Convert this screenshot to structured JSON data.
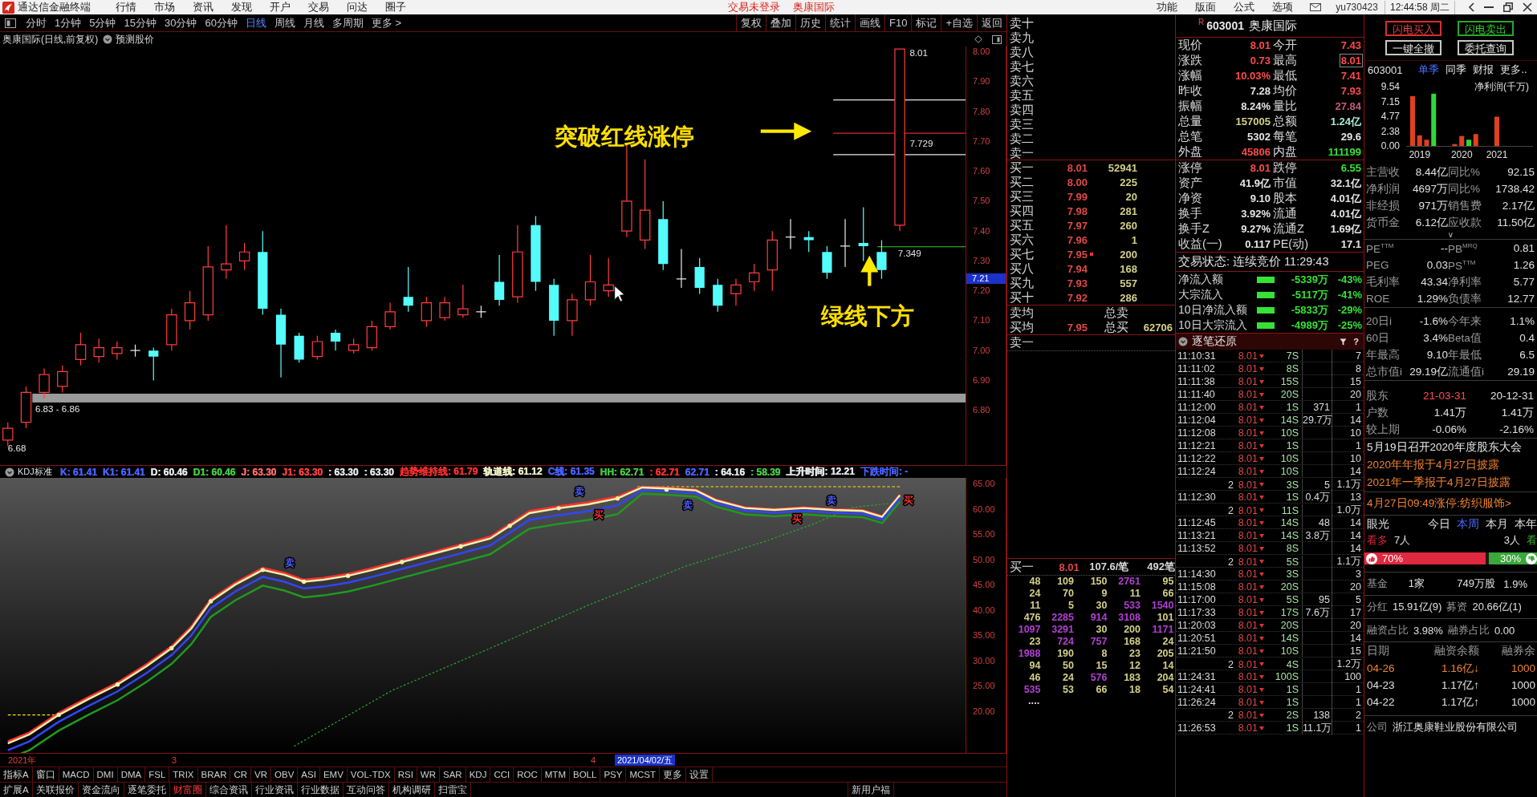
{
  "title_bar": {
    "app_name": "通达信金融终端",
    "menu": [
      "行情",
      "市场",
      "资讯",
      "发现",
      "开户",
      "交易",
      "问达",
      "圈子"
    ],
    "login_status": "交易未登录",
    "stock_name": "奥康国际",
    "right_menu": [
      "功能",
      "版面",
      "公式",
      "选项"
    ],
    "user": "yu730423",
    "clock": "12:44:58 周二"
  },
  "period_bar": {
    "tabs": [
      {
        "label": "分时",
        "selected": false
      },
      {
        "label": "1分钟",
        "selected": false
      },
      {
        "label": "5分钟",
        "selected": false
      },
      {
        "label": "15分钟",
        "selected": false
      },
      {
        "label": "30分钟",
        "selected": false
      },
      {
        "label": "60分钟",
        "selected": false
      },
      {
        "label": "日线",
        "selected": true
      },
      {
        "label": "周线",
        "selected": false
      },
      {
        "label": "月线",
        "selected": false
      },
      {
        "label": "多周期",
        "selected": false
      },
      {
        "label": "更多 >",
        "selected": false
      }
    ],
    "tools": [
      "复权",
      "叠加",
      "历史",
      "统计",
      "画线",
      "F10",
      "标记",
      "+自选",
      "返回"
    ]
  },
  "chart": {
    "title": "奥康国际(日线,前复权)",
    "forecast_label": "预测股价",
    "price_axis": [
      "8.00",
      "7.90",
      "7.80",
      "7.70",
      "7.60",
      "7.50",
      "7.40",
      "7.30",
      "7.20",
      "7.10",
      "7.00",
      "6.90",
      "6.80"
    ],
    "cursor_price": "7.21",
    "labels": [
      {
        "kind": "high",
        "text": "8.01"
      },
      {
        "kind": "resistance",
        "text": "7.729"
      },
      {
        "kind": "support",
        "text": "7.349"
      },
      {
        "kind": "band",
        "text": "6.83 - 6.86"
      },
      {
        "kind": "low",
        "text": "6.68"
      }
    ],
    "annotations": [
      {
        "kind": "right-arrow",
        "text": "突破红线涨停"
      },
      {
        "kind": "up-arrow",
        "text": "绿线下方"
      }
    ]
  },
  "indicator": {
    "name": "KDJ标准",
    "readouts": [
      {
        "text": "K: 61.41",
        "color": "#4a63ff"
      },
      {
        "text": "K1: 61.41",
        "color": "#4a63ff"
      },
      {
        "text": "D: 60.46",
        "color": "#e6e6e6"
      },
      {
        "text": "D1: 60.46",
        "color": "#46c846"
      },
      {
        "text": "J: 63.30",
        "color": "#ff6a6a"
      },
      {
        "text": "J1: 63.30",
        "color": "#ff4040"
      },
      {
        "text": ": 63.30",
        "color": "#e6e6e6"
      },
      {
        "text": ": 63.30",
        "color": "#e6e6e6"
      },
      {
        "text": "趋势维持线: 61.79",
        "color": "#ff3030"
      },
      {
        "text": "轨道线: 61.12",
        "color": "#f2f2c8"
      },
      {
        "text": "C线: 61.35",
        "color": "#4a63ff"
      },
      {
        "text": "HH: 62.71",
        "color": "#46c846"
      },
      {
        "text": ": 62.71",
        "color": "#ff3030"
      },
      {
        "text": "62.71",
        "color": "#4a63ff"
      },
      {
        "text": ": 64.16",
        "color": "#e6e6e6"
      },
      {
        "text": ": 58.39",
        "color": "#46c846"
      },
      {
        "text": "上升时间: 12.21",
        "color": "#e6e6e6"
      },
      {
        "text": "下跌时间: -",
        "color": "#4a63ff"
      }
    ],
    "signals": [
      {
        "kind": "sell",
        "text": "卖"
      },
      {
        "kind": "sell",
        "text": "卖"
      },
      {
        "kind": "buy",
        "text": "买"
      },
      {
        "kind": "sell",
        "text": "卖"
      },
      {
        "kind": "buy",
        "text": "买"
      },
      {
        "kind": "sell",
        "text": "卖"
      },
      {
        "kind": "buy",
        "text": "买"
      }
    ],
    "axis": [
      "65.00",
      "60.00",
      "55.00",
      "50.00",
      "45.00",
      "40.00",
      "35.00",
      "30.00",
      "25.00",
      "20.00"
    ]
  },
  "date_axis": {
    "labels": [
      "2021年",
      "3",
      "4"
    ],
    "cursor_date": "2021/04/02/五"
  },
  "indicator_bar": {
    "tabs": [
      {
        "label": "指标A",
        "selected": false
      },
      {
        "label": "窗口",
        "selected": false
      },
      {
        "label": "MACD",
        "selected": false
      },
      {
        "label": "DMI",
        "selected": false
      },
      {
        "label": "DMA",
        "selected": false
      },
      {
        "label": "FSL",
        "selected": false
      },
      {
        "label": "TRIX",
        "selected": false
      },
      {
        "label": "BRAR",
        "selected": false
      },
      {
        "label": "CR",
        "selected": false
      },
      {
        "label": "VR",
        "selected": false
      },
      {
        "label": "OBV",
        "selected": false
      },
      {
        "label": "ASI",
        "selected": false
      },
      {
        "label": "EMV",
        "selected": false
      },
      {
        "label": "VOL-TDX",
        "selected": false
      },
      {
        "label": "RSI",
        "selected": false
      },
      {
        "label": "WR",
        "selected": false
      },
      {
        "label": "SAR",
        "selected": false
      },
      {
        "label": "KDJ",
        "selected": false
      },
      {
        "label": "CCI",
        "selected": false
      },
      {
        "label": "ROC",
        "selected": false
      },
      {
        "label": "MTM",
        "selected": false
      },
      {
        "label": "BOLL",
        "selected": false
      },
      {
        "label": "PSY",
        "selected": false
      },
      {
        "label": "MCST",
        "selected": false
      },
      {
        "label": "更多",
        "selected": false
      },
      {
        "label": "设置",
        "selected": false
      }
    ]
  },
  "extension_bar": {
    "tabs": [
      {
        "label": "扩展A",
        "selected": false
      },
      {
        "label": "关联报价",
        "selected": false
      },
      {
        "label": "资金流向",
        "selected": false
      },
      {
        "label": "逐笔委托",
        "selected": false
      },
      {
        "label": "财富圈",
        "selected": true
      },
      {
        "label": "综合资讯",
        "selected": false
      },
      {
        "label": "行业资讯",
        "selected": false
      },
      {
        "label": "行业数据",
        "selected": false
      },
      {
        "label": "互动问答",
        "selected": false
      },
      {
        "label": "机构调研",
        "selected": false
      },
      {
        "label": "扫雷宝",
        "selected": false
      }
    ],
    "note": "新用户福"
  },
  "order_book": {
    "asks": [
      "卖十",
      "卖九",
      "卖八",
      "卖七",
      "卖六",
      "卖五",
      "卖四",
      "卖三",
      "卖二",
      "卖一"
    ],
    "bids": [
      {
        "label": "买一",
        "price": "8.01",
        "volume": "52941",
        "marked": false
      },
      {
        "label": "买二",
        "price": "8.00",
        "volume": "225",
        "marked": false
      },
      {
        "label": "买三",
        "price": "7.99",
        "volume": "20",
        "marked": false
      },
      {
        "label": "买四",
        "price": "7.98",
        "volume": "281",
        "marked": false
      },
      {
        "label": "买五",
        "price": "7.97",
        "volume": "260",
        "marked": false
      },
      {
        "label": "买六",
        "price": "7.96",
        "volume": "1",
        "marked": false
      },
      {
        "label": "买七",
        "price": "7.95",
        "volume": "200",
        "marked": true
      },
      {
        "label": "买八",
        "price": "7.94",
        "volume": "168",
        "marked": false
      },
      {
        "label": "买九",
        "price": "7.93",
        "volume": "557",
        "marked": false
      },
      {
        "label": "买十",
        "price": "7.92",
        "volume": "286",
        "marked": false
      }
    ],
    "avg_ask": {
      "label": "卖均",
      "total_label": "总卖"
    },
    "avg_bid": {
      "label": "买均",
      "price": "7.95",
      "total_label": "总买",
      "total": "62706"
    },
    "ask_queue": {
      "label": "卖一"
    },
    "bid_queue": {
      "label": "买一",
      "price": "8.01",
      "per_order": "107.6/笔",
      "orders": "492笔",
      "rows": [
        [
          {
            "text": "48",
            "large": false
          },
          {
            "text": "109",
            "large": false
          },
          {
            "text": "150",
            "large": false
          },
          {
            "text": "2761",
            "large": true
          },
          {
            "text": "95",
            "large": false
          }
        ],
        [
          {
            "text": "24",
            "large": false
          },
          {
            "text": "70",
            "large": false
          },
          {
            "text": "9",
            "large": false
          },
          {
            "text": "11",
            "large": false
          },
          {
            "text": "66",
            "large": false
          }
        ],
        [
          {
            "text": "11",
            "large": false
          },
          {
            "text": "5",
            "large": false
          },
          {
            "text": "30",
            "large": false
          },
          {
            "text": "533",
            "large": true
          },
          {
            "text": "1540",
            "large": true
          }
        ],
        [
          {
            "text": "476",
            "large": false
          },
          {
            "text": "2285",
            "large": true
          },
          {
            "text": "914",
            "large": true
          },
          {
            "text": "3108",
            "large": true
          },
          {
            "text": "101",
            "large": false
          }
        ],
        [
          {
            "text": "1097",
            "large": true
          },
          {
            "text": "3291",
            "large": true
          },
          {
            "text": "30",
            "large": false
          },
          {
            "text": "200",
            "large": false
          },
          {
            "text": "1171",
            "large": true
          }
        ],
        [
          {
            "text": "23",
            "large": false
          },
          {
            "text": "724",
            "large": true
          },
          {
            "text": "757",
            "large": true
          },
          {
            "text": "168",
            "large": false
          },
          {
            "text": "24",
            "large": false
          }
        ],
        [
          {
            "text": "1988",
            "large": true
          },
          {
            "text": "190",
            "large": false
          },
          {
            "text": "8",
            "large": false
          },
          {
            "text": "23",
            "large": false
          },
          {
            "text": "205",
            "large": false
          }
        ],
        [
          {
            "text": "94",
            "large": false
          },
          {
            "text": "50",
            "large": false
          },
          {
            "text": "15",
            "large": false
          },
          {
            "text": "12",
            "large": false
          },
          {
            "text": "14",
            "large": false
          }
        ],
        [
          {
            "text": "46",
            "large": false
          },
          {
            "text": "24",
            "large": false
          },
          {
            "text": "576",
            "large": true
          },
          {
            "text": "183",
            "large": false
          },
          {
            "text": "204",
            "large": false
          }
        ],
        [
          {
            "text": "535",
            "large": true
          },
          {
            "text": "53",
            "large": false
          },
          {
            "text": "66",
            "large": false
          },
          {
            "text": "18",
            "large": false
          },
          {
            "text": "54",
            "large": false
          }
        ]
      ],
      "more": "...."
    }
  },
  "quote": {
    "badge": "R",
    "code": "603001",
    "name": "奥康国际",
    "price_rows": [
      [
        {
          "label": "现价",
          "value": "8.01",
          "kind": "up",
          "highlighted": false
        },
        {
          "label": "今开",
          "value": "7.43",
          "kind": "up",
          "highlighted": false
        }
      ],
      [
        {
          "label": "涨跌",
          "value": "0.73",
          "kind": "up",
          "highlighted": false
        },
        {
          "label": "最高",
          "value": "8.01",
          "kind": "up",
          "highlighted": true
        }
      ],
      [
        {
          "label": "涨幅",
          "value": "10.03%",
          "kind": "up",
          "highlighted": false
        },
        {
          "label": "最低",
          "value": "7.41",
          "kind": "up",
          "highlighted": false
        }
      ],
      [
        {
          "label": "昨收",
          "value": "7.28",
          "kind": "flat",
          "highlighted": false
        },
        {
          "label": "均价",
          "value": "7.93",
          "kind": "up",
          "highlighted": false
        }
      ],
      [
        {
          "label": "振幅",
          "value": "8.24%",
          "kind": "flat",
          "highlighted": false
        },
        {
          "label": "量比",
          "value": "27.84",
          "kind": "ratio",
          "highlighted": false
        }
      ],
      [
        {
          "label": "总量",
          "value": "157005",
          "kind": "volume",
          "highlighted": false
        },
        {
          "label": "总额",
          "value": "1.24亿",
          "kind": "amount",
          "highlighted": false
        }
      ],
      [
        {
          "label": "总笔",
          "value": "5302",
          "kind": "flat",
          "highlighted": false
        },
        {
          "label": "每笔",
          "value": "29.6",
          "kind": "flat",
          "highlighted": false
        }
      ],
      [
        {
          "label": "外盘",
          "value": "45806",
          "kind": "up",
          "highlighted": false
        },
        {
          "label": "内盘",
          "value": "111199",
          "kind": "down",
          "highlighted": false
        }
      ]
    ],
    "stat_rows": [
      [
        {
          "label": "涨停",
          "value": "8.01",
          "kind": "up"
        },
        {
          "label": "跌停",
          "value": "6.55",
          "kind": "down"
        }
      ],
      [
        {
          "label": "资产",
          "value": "41.9亿",
          "kind": "flat"
        },
        {
          "label": "市值",
          "value": "32.1亿",
          "kind": "flat"
        }
      ],
      [
        {
          "label": "净资",
          "value": "9.10",
          "kind": "flat"
        },
        {
          "label": "股本",
          "value": "4.01亿",
          "kind": "flat"
        }
      ],
      [
        {
          "label": "换手",
          "value": "3.92%",
          "kind": "flat"
        },
        {
          "label": "流通",
          "value": "4.01亿",
          "kind": "flat"
        }
      ],
      [
        {
          "label": "换手Z",
          "value": "9.27%",
          "kind": "flat"
        },
        {
          "label": "流通Z",
          "value": "1.69亿",
          "kind": "flat"
        }
      ],
      [
        {
          "label": "收益(一)",
          "value": "0.117",
          "kind": "flat"
        },
        {
          "label": "PE(动)",
          "value": "17.1",
          "kind": "flat"
        }
      ]
    ],
    "trade_status": "交易状态: 连续竞价 11:29:43",
    "fund_flows": [
      {
        "label": "净流入额",
        "value": "-5339万",
        "percent": "-43%",
        "kind": "down"
      },
      {
        "label": "大宗流入",
        "value": "-5117万",
        "percent": "-41%",
        "kind": "down"
      },
      {
        "label": "10日净流入额",
        "value": "-5833万",
        "percent": "-29%",
        "kind": "down"
      },
      {
        "label": "10日大宗流入",
        "value": "-4989万",
        "percent": "-25%",
        "kind": "down"
      }
    ]
  },
  "tick_panel": {
    "title": "逐笔还原",
    "help": "?",
    "rows": [
      {
        "kind": "trade",
        "time": "11:10:31",
        "price": "8.01",
        "volume": "7S",
        "count": "7"
      },
      {
        "kind": "trade",
        "time": "11:11:02",
        "price": "8.01",
        "volume": "8S",
        "count": "8"
      },
      {
        "kind": "trade",
        "time": "11:11:38",
        "price": "8.01",
        "volume": "15S",
        "count": "15"
      },
      {
        "kind": "trade",
        "time": "11:11:40",
        "price": "8.01",
        "volume": "20S",
        "count": "20"
      },
      {
        "kind": "trade",
        "time": "11:12:00",
        "price": "8.01",
        "volume": "1S",
        "block": "371",
        "count": "1"
      },
      {
        "kind": "trade",
        "time": "11:12:04",
        "price": "8.01",
        "volume": "14S",
        "block": "29.7万",
        "count": "14"
      },
      {
        "kind": "trade",
        "time": "11:12:08",
        "price": "8.01",
        "volume": "10S",
        "count": "10"
      },
      {
        "kind": "trade",
        "time": "11:12:21",
        "price": "8.01",
        "volume": "1S",
        "count": "1"
      },
      {
        "kind": "trade",
        "time": "11:12:22",
        "price": "8.01",
        "volume": "10S",
        "count": "10"
      },
      {
        "kind": "trade",
        "time": "11:12:24",
        "price": "8.01",
        "volume": "10S",
        "count": "14"
      },
      {
        "kind": "split",
        "time": "2",
        "price": "8.01",
        "volume": "3S",
        "block": "5",
        "count": "1.1万"
      },
      {
        "kind": "trade",
        "time": "11:12:30",
        "price": "8.01",
        "volume": "1S",
        "block": "0.4万",
        "count": "13"
      },
      {
        "kind": "split",
        "time": "2",
        "price": "8.01",
        "volume": "11S",
        "count": "1.0万"
      },
      {
        "kind": "trade",
        "time": "11:12:45",
        "price": "8.01",
        "volume": "14S",
        "block": "48",
        "count": "14"
      },
      {
        "kind": "trade",
        "time": "11:13:21",
        "price": "8.01",
        "volume": "14S",
        "block": "3.8万",
        "count": "14"
      },
      {
        "kind": "trade",
        "time": "11:13:52",
        "price": "8.01",
        "volume": "8S",
        "count": "14"
      },
      {
        "kind": "split",
        "time": "2",
        "price": "8.01",
        "volume": "5S",
        "count": "1.1万"
      },
      {
        "kind": "trade",
        "time": "11:14:30",
        "price": "8.01",
        "volume": "3S",
        "count": "3"
      },
      {
        "kind": "trade",
        "time": "11:15:08",
        "price": "8.01",
        "volume": "20S",
        "count": "20"
      },
      {
        "kind": "trade",
        "time": "11:17:00",
        "price": "8.01",
        "volume": "5S",
        "block": "95",
        "count": "5"
      },
      {
        "kind": "trade",
        "time": "11:17:33",
        "price": "8.01",
        "volume": "17S",
        "block": "7.6万",
        "count": "17"
      },
      {
        "kind": "trade",
        "time": "11:20:03",
        "price": "8.01",
        "volume": "20S",
        "count": "20"
      },
      {
        "kind": "trade",
        "time": "11:20:51",
        "price": "8.01",
        "volume": "14S",
        "count": "14"
      },
      {
        "kind": "trade",
        "time": "11:21:50",
        "price": "8.01",
        "volume": "10S",
        "count": "15"
      },
      {
        "kind": "split",
        "time": "2",
        "price": "8.01",
        "volume": "4S",
        "count": "1.2万"
      },
      {
        "kind": "trade",
        "time": "11:24:31",
        "price": "8.01",
        "volume": "100S",
        "count": "100"
      },
      {
        "kind": "trade",
        "time": "11:24:41",
        "price": "8.01",
        "volume": "1S",
        "count": "1"
      },
      {
        "kind": "trade",
        "time": "11:26:24",
        "price": "8.01",
        "volume": "1S",
        "count": "1"
      },
      {
        "kind": "split",
        "time": "2",
        "price": "8.01",
        "volume": "2S",
        "block": "138",
        "count": "2"
      },
      {
        "kind": "trade",
        "time": "11:26:53",
        "price": "8.01",
        "volume": "1S",
        "block": "11.1万",
        "count": "1"
      }
    ]
  },
  "trade_buttons": [
    {
      "label": "闪电买入",
      "kind": "buy"
    },
    {
      "label": "闪电卖出",
      "kind": "sell"
    },
    {
      "label": "一键全撤",
      "kind": "plain"
    },
    {
      "label": "委托查询",
      "kind": "plain"
    }
  ],
  "finance": {
    "code": "603001",
    "tabs": [
      {
        "label": "单季",
        "selected": true
      },
      {
        "label": "同季",
        "selected": false
      },
      {
        "label": "财报",
        "selected": false
      },
      {
        "label": "更多..",
        "selected": false
      }
    ],
    "chart_data": {
      "type": "bar",
      "title": "净利润(千万)",
      "categories": [
        null,
        "2019",
        null,
        null,
        null,
        null,
        null,
        "2020",
        null,
        null,
        null,
        null,
        "2021"
      ],
      "stacked": true,
      "ylim": [
        0,
        9.54
      ],
      "yticks": [
        {
          "value": 0,
          "label": "0.00"
        },
        2.38,
        4.77,
        7.15,
        9.54
      ],
      "series": [
        {
          "color": "#e0401e",
          "values": [
            8.0,
            1.7,
            1.0,
            null,
            null,
            null,
            0.3,
            1.6,
            null,
            1.9,
            null,
            null,
            4.7
          ]
        },
        {
          "color": "#2ed838",
          "values": [
            null,
            null,
            null,
            8.4,
            null,
            null,
            null,
            null,
            1.0,
            null,
            null,
            null,
            null
          ]
        }
      ]
    },
    "rows": [
      [
        {
          "label": "主营收",
          "value": "8.44亿"
        },
        {
          "label": "同比%",
          "value": "92.15"
        }
      ],
      [
        {
          "label": "净利润",
          "value": "4697万"
        },
        {
          "label": "同比%",
          "value": "1738.42"
        }
      ],
      [
        {
          "label": "非经损",
          "value": "971万"
        },
        {
          "label": "销售费",
          "value": "2.17亿"
        }
      ],
      [
        {
          "label": "货币金",
          "value": "6.12亿"
        },
        {
          "label": "应收款",
          "value": "11.50亿"
        }
      ]
    ],
    "expand_toggle": "∨"
  },
  "valuation_rows": [
    [
      {
        "label": "PE$^{TTM}$",
        "value": "--"
      },
      {
        "label": "PB$^{MRQ}$",
        "value": "0.81"
      }
    ],
    [
      {
        "label": "PEG",
        "value": "0.03"
      },
      {
        "label": "PS$^{TTM}$",
        "value": "1.26"
      }
    ],
    [
      {
        "label": "毛利率",
        "value": "43.34"
      },
      {
        "label": "净利率",
        "value": "5.77"
      }
    ],
    [
      {
        "label": "ROE",
        "value": "1.29%"
      },
      {
        "label": "负债率",
        "value": "12.77"
      }
    ]
  ],
  "performance_rows": [
    [
      {
        "label": "20日i",
        "value": "-1.6%"
      },
      {
        "label": "今年来",
        "value": "1.1%"
      }
    ],
    [
      {
        "label": "60日",
        "value": "3.4%"
      },
      {
        "label": "Beta值",
        "value": "0.4"
      }
    ],
    [
      {
        "label": "年最高",
        "value": "9.10"
      },
      {
        "label": "年最低",
        "value": "6.5"
      }
    ],
    [
      {
        "label": "总市值i",
        "value": "29.19亿"
      },
      {
        "label": "流通值i",
        "value": "29.19"
      }
    ]
  ],
  "shareholders": {
    "label": "股东",
    "dates": [
      {
        "text": "21-03-31",
        "selected": true
      },
      {
        "text": "20-12-31",
        "selected": false
      }
    ],
    "rows": [
      {
        "label": "户数",
        "values": [
          "1.41万",
          "1.41万"
        ]
      },
      {
        "label": "较上期",
        "values": [
          "-0.06%",
          "-2.16%"
        ]
      }
    ]
  },
  "news": [
    {
      "text": "5月19日召开2020年度股东大会",
      "color": "#e8e8e8"
    },
    {
      "text": "2020年年报于4月27日披露",
      "color": "#f08232"
    },
    {
      "text": "2021年一季报于4月27日披露",
      "color": "#f08232"
    }
  ],
  "limit_up_note": "4月27日09:49涨停:纺织服饰>",
  "sentiment": {
    "title": "眼光",
    "periods": [
      {
        "label": "今日",
        "selected": false
      },
      {
        "label": "本周",
        "selected": true
      },
      {
        "label": "本月",
        "selected": false
      },
      {
        "label": "本年",
        "selected": false
      }
    ],
    "bull_label": "看多",
    "bull_count": "7人",
    "bear_count": "3人",
    "bear_label": "看",
    "bull_percent": "70%",
    "bear_percent": "30%",
    "level": 0.7
  },
  "fund_holding": {
    "label": "基金",
    "institutions": "1家",
    "shares": "749万股",
    "ratio": "1.9%"
  },
  "dividend": {
    "label": "分红",
    "value": "15.91亿(9)",
    "raise_label": "募资",
    "raise_value": "20.66亿(1)"
  },
  "margin_ratio": {
    "label": "融资占比",
    "value": "3.98%",
    "short_label": "融券占比",
    "short_value": "0.00"
  },
  "margin_table": {
    "columns": [
      "日期",
      "融资余额",
      "融券余"
    ],
    "rows": [
      {
        "date": "04-26",
        "balance": "1.16亿↓",
        "short": "1000",
        "selected": true
      },
      {
        "date": "04-23",
        "balance": "1.17亿↑",
        "short": "1000",
        "selected": false
      },
      {
        "date": "04-22",
        "balance": "1.17亿↑",
        "short": "1000",
        "selected": false
      }
    ]
  },
  "company": {
    "label": "公司",
    "name": "浙江奥康鞋业股份有限公司"
  }
}
